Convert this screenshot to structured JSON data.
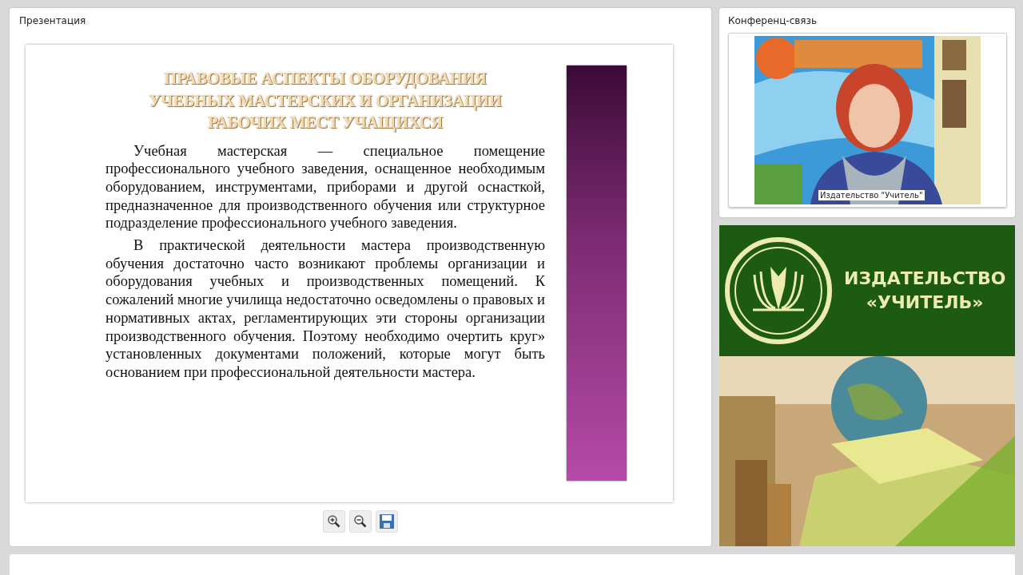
{
  "presentation": {
    "title": "Презентация",
    "slide": {
      "heading": [
        "ПРАВОВЫЕ АСПЕКТЫ ОБОРУДОВАНИЯ",
        "УЧЕБНЫХ МАСТЕРСКИХ И ОРГАНИЗАЦИИ",
        "РАБОЧИХ МЕСТ УЧАЩИХСЯ"
      ],
      "paragraphs": [
        "Учебная мастерская — специальное помещение профессионального учебного заведения, оснащенное необходимым оборудованием, инструментами, приборами и другой оснасткой, предназначенное для производственного обучения или структурное подразделение профессионального учебного заведения.",
        "В практической деятельности мастера производственную обучения достаточно часто возникают проблемы организации и оборудования учебных и производственных помещений. К сожалений многие училища недостаточно осведомлены о правовых и нормативных актах, регламентирующих эти стороны организации производственного обучения. Поэтому необходимо очертить круг» установленных документами положений, которые могут быть основанием при профессиональной деятельности мастера."
      ]
    },
    "toolbar": [
      {
        "kind": "zoom-in"
      },
      {
        "kind": "zoom-out"
      },
      {
        "kind": "save"
      }
    ]
  },
  "conference": {
    "title": "Конференц-связь",
    "video": {
      "kind": "picture",
      "caption": "Издательство \"Учитель\""
    }
  },
  "banner": {
    "lines": [
      "ИЗДАТЕЛЬСТВО",
      "«УЧИТЕЛЬ»"
    ],
    "photo": {
      "kind": "picture"
    }
  }
}
